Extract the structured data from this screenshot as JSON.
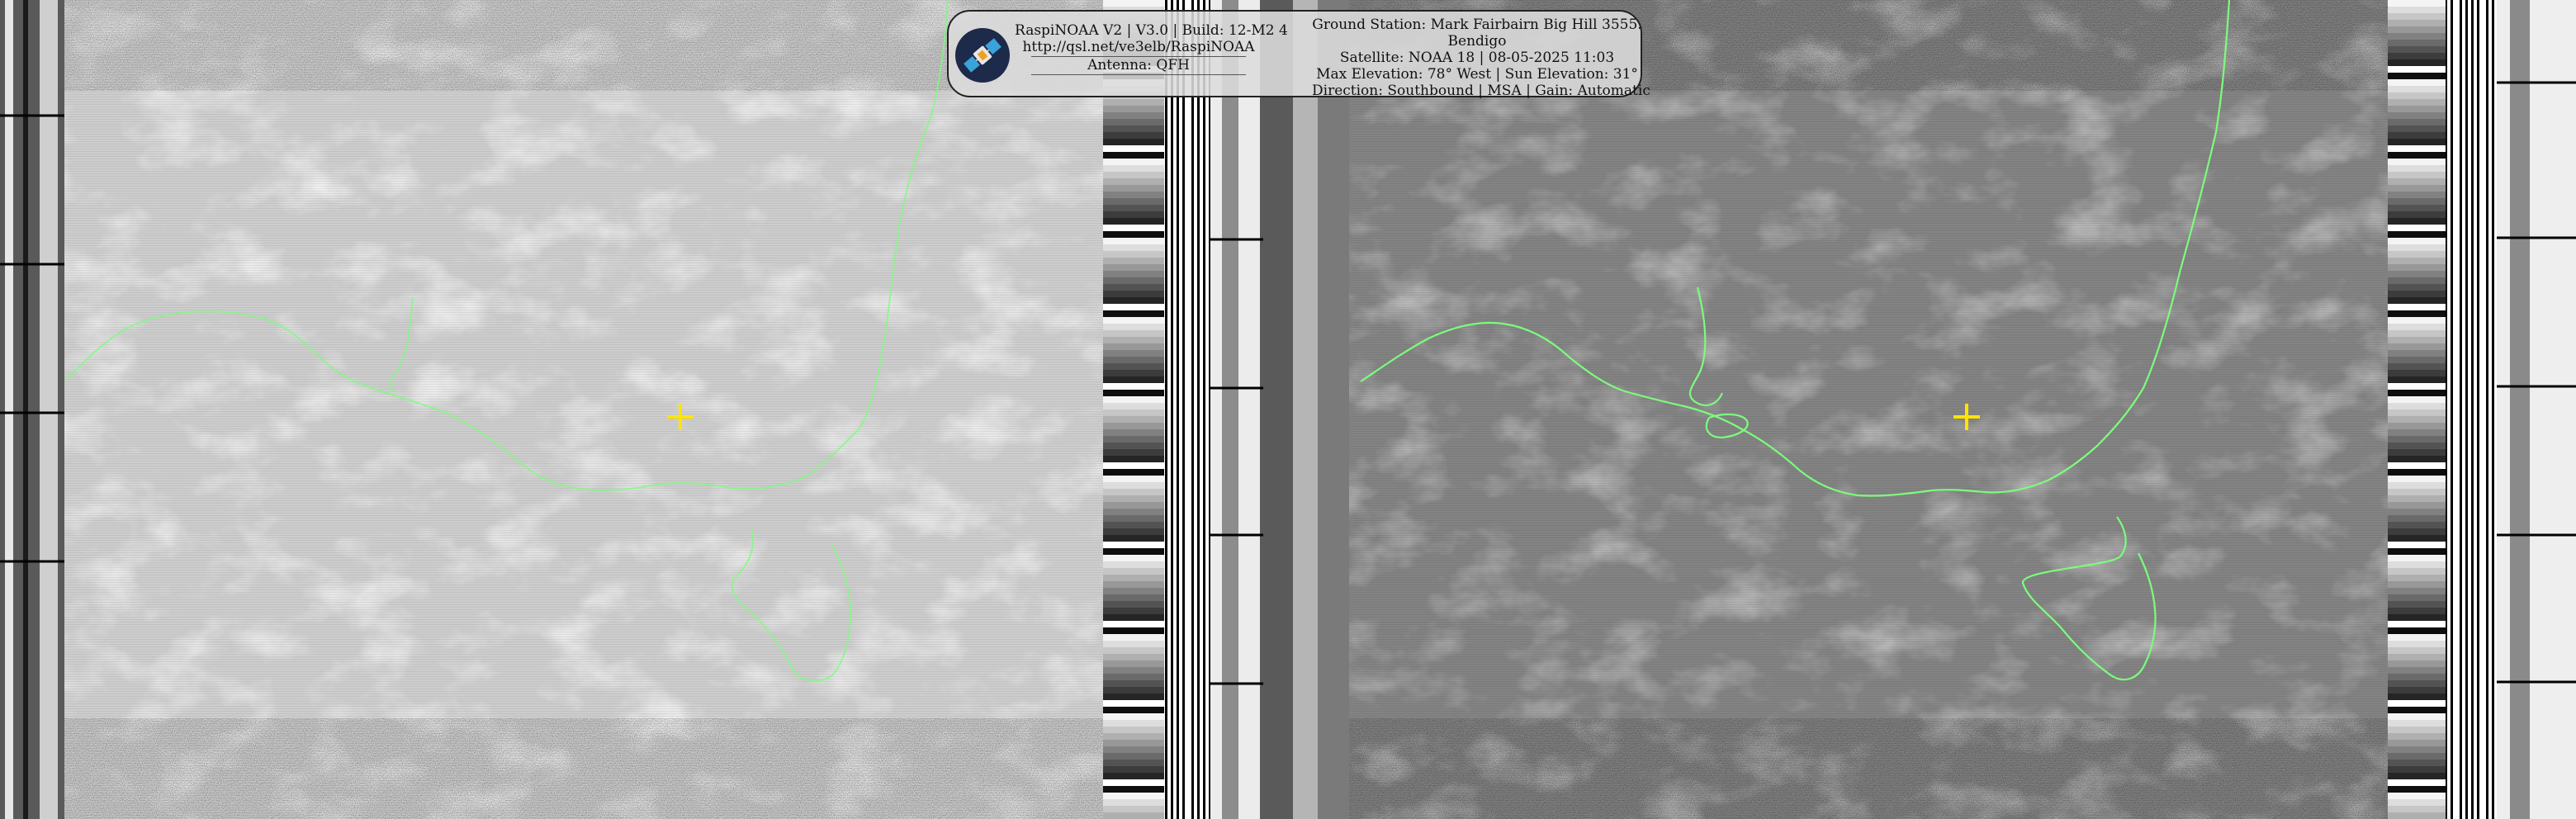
{
  "overlay": {
    "app_line": "RaspiNOAA V2 | V3.0 | Build: 12-M2 4",
    "url": "http://qsl.net/ve3elb/RaspiNOAA",
    "antenna": "Antenna: QFH",
    "station_line1": "Ground Station: Mark Fairbairn Big Hill 3555.",
    "station_line2": "Bendigo",
    "satellite": "Satellite: NOAA 18 | 08-05-2025 11:03",
    "elevation": "Max Elevation: 78° West | Sun Elevation: 31°",
    "direction": "Direction: Southbound | MSA | Gain: Automatic",
    "logo_icon": "satellite-icon"
  },
  "colors": {
    "coastline": "#7CFC7C",
    "marker": "#FFE400",
    "overlay_bg": "#DCDCDC"
  }
}
